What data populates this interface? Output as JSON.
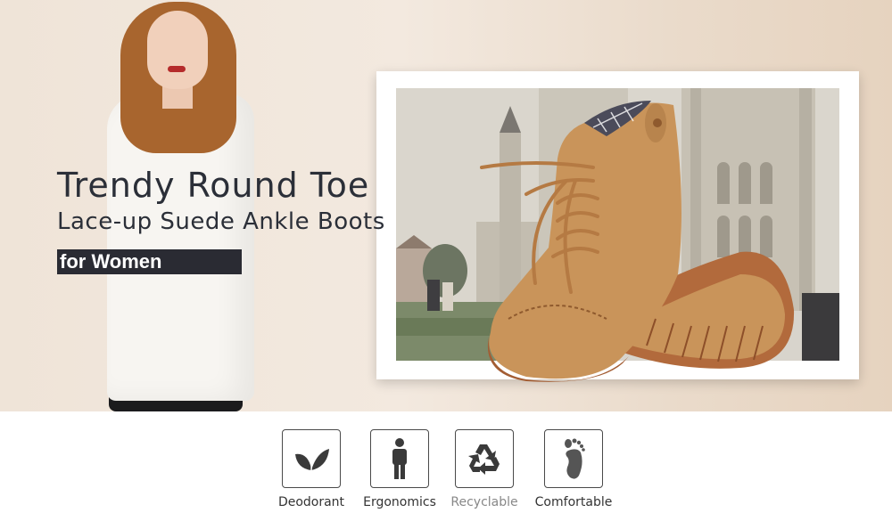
{
  "hero": {
    "title_line1": "Trendy Round Toe",
    "title_line2": "Lace-up Suede Ankle Boots",
    "tag": "for Women"
  },
  "features": [
    {
      "label": "Deodorant",
      "icon": "leaf-icon"
    },
    {
      "label": "Ergonomics",
      "icon": "person-icon"
    },
    {
      "label": "Recyclable",
      "icon": "recycle-icon"
    },
    {
      "label": "Comfortable",
      "icon": "footprint-icon"
    }
  ],
  "colors": {
    "title_text": "#2b2f38",
    "tag_background": "#2a2b33",
    "boot_suede": "#c9945a",
    "sole": "#b26a3c"
  }
}
